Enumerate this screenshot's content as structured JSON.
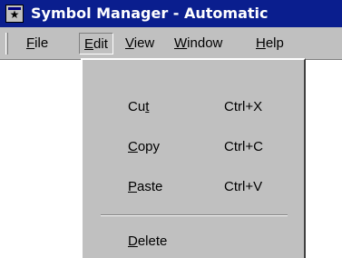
{
  "window": {
    "title": "Symbol Manager - Automatic",
    "icon": "star-app-icon"
  },
  "menubar": {
    "items": [
      {
        "label_accel": "F",
        "label_rest": "ile",
        "label": "File"
      },
      {
        "label_accel": "E",
        "label_rest": "dit",
        "label": "Edit"
      },
      {
        "label_accel": "V",
        "label_rest": "iew",
        "label": "View"
      },
      {
        "label_accel": "W",
        "label_rest": "indow",
        "label": "Window"
      },
      {
        "label_accel": "H",
        "label_rest": "elp",
        "label": "Help"
      }
    ],
    "open_menu": "Edit"
  },
  "edit_menu": {
    "items": [
      {
        "label": "Cut",
        "pre": "Cu",
        "accel": "t",
        "post": "",
        "shortcut": "Ctrl+X"
      },
      {
        "label": "Copy",
        "pre": "",
        "accel": "C",
        "post": "opy",
        "shortcut": "Ctrl+C"
      },
      {
        "label": "Paste",
        "pre": "",
        "accel": "P",
        "post": "aste",
        "shortcut": "Ctrl+V"
      },
      {
        "label": "Delete",
        "pre": "",
        "accel": "D",
        "post": "elete",
        "shortcut": ""
      }
    ]
  },
  "colors": {
    "titlebar": "#0a1e8e",
    "face": "#c0c0c0",
    "highlight": "#ffffff",
    "shadow": "#808080"
  }
}
